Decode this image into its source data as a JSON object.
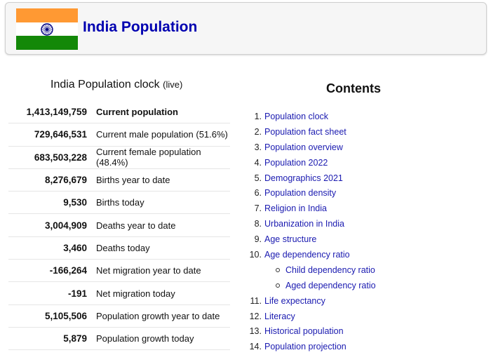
{
  "header": {
    "title": "India Population",
    "flag": "india-flag"
  },
  "clock": {
    "title": "India Population clock",
    "live": "(live)",
    "rows": [
      {
        "value": "1,413,149,759",
        "label": "Current population"
      },
      {
        "value": "729,646,531",
        "label": "Current male population (51.6%)"
      },
      {
        "value": "683,503,228",
        "label": "Current female population (48.4%)"
      },
      {
        "value": "8,276,679",
        "label": "Births year to date"
      },
      {
        "value": "9,530",
        "label": "Births today"
      },
      {
        "value": "3,004,909",
        "label": "Deaths year to date"
      },
      {
        "value": "3,460",
        "label": "Deaths today"
      },
      {
        "value": "-166,264",
        "label": "Net migration year to date"
      },
      {
        "value": "-191",
        "label": "Net migration today"
      },
      {
        "value": "5,105,506",
        "label": "Population growth year to date"
      },
      {
        "value": "5,879",
        "label": "Population growth today"
      }
    ]
  },
  "contents": {
    "title": "Contents",
    "items": [
      {
        "num": "1.",
        "label": "Population clock"
      },
      {
        "num": "2.",
        "label": "Population fact sheet"
      },
      {
        "num": "3.",
        "label": "Population overview"
      },
      {
        "num": "4.",
        "label": "Population 2022"
      },
      {
        "num": "5.",
        "label": "Demographics 2021"
      },
      {
        "num": "6.",
        "label": "Population density"
      },
      {
        "num": "7.",
        "label": "Religion in India"
      },
      {
        "num": "8.",
        "label": "Urbanization in India"
      },
      {
        "num": "9.",
        "label": "Age structure"
      },
      {
        "num": "10.",
        "label": "Age dependency ratio"
      },
      {
        "num": "",
        "label": "Child dependency ratio",
        "sub": true
      },
      {
        "num": "",
        "label": "Aged dependency ratio",
        "sub": true
      },
      {
        "num": "11.",
        "label": "Life expectancy"
      },
      {
        "num": "12.",
        "label": "Literacy"
      },
      {
        "num": "13.",
        "label": "Historical population"
      },
      {
        "num": "14.",
        "label": "Population projection"
      }
    ]
  }
}
